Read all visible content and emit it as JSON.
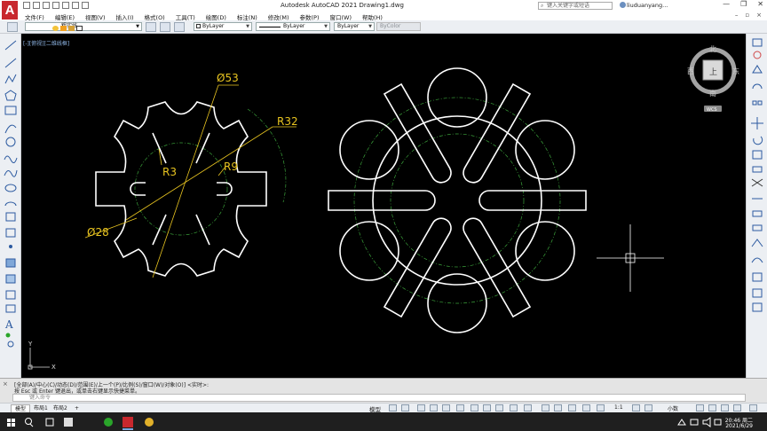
{
  "titlebar": {
    "app_title": "Autodesk AutoCAD 2021    Drawing1.dwg",
    "search_placeholder": "键入关键字或短语",
    "user": "liuduanyang...",
    "logo": "A"
  },
  "menu": {
    "items": [
      "文件(F)",
      "编辑(E)",
      "视图(V)",
      "插入(I)",
      "格式(O)",
      "工具(T)",
      "绘图(D)",
      "标注(N)",
      "修改(M)",
      "参数(P)",
      "窗口(W)",
      "帮助(H)"
    ]
  },
  "toolbar": {
    "layer": "粗实线",
    "color": "ByLayer",
    "linetype": "ByLayer",
    "lineweight": "ByLayer",
    "plotstyle": "ByColor"
  },
  "canvas": {
    "view_label": "[-][俯视][二维线框]",
    "dimensions": {
      "d53": "Ø53",
      "r32": "R32",
      "r3": "R3",
      "r9": "R9",
      "d28": "Ø28"
    },
    "viewcube": {
      "north": "北",
      "south": "南",
      "east": "东",
      "west": "西",
      "face": "上",
      "wcs": "WCS"
    },
    "ucs": {
      "x": "X",
      "y": "Y"
    }
  },
  "command": {
    "history1": "[全部(A)/中心(C)/动态(D)/范围(E)/上一个(P)/比例(S)/窗口(W)/对象(O)] <实时>:",
    "history2": "按 Esc 或 Enter 键退出，或单击右键显示快捷菜单。",
    "input_placeholder": "键入命令"
  },
  "layout_tabs": [
    "模型",
    "布局1",
    "布局2",
    "+"
  ],
  "status": {
    "model": "模型",
    "scale": "1:1",
    "units": "小数"
  },
  "taskbar": {
    "time": "20:46 周二",
    "date": "2021/6/29"
  }
}
